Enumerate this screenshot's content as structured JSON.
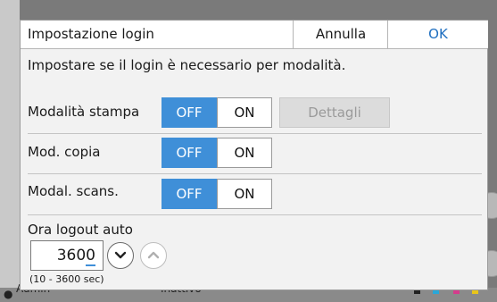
{
  "dialog": {
    "title": "Impostazione login",
    "cancel_label": "Annulla",
    "ok_label": "OK",
    "description": "Impostare se il login è necessario per modalità."
  },
  "rows": [
    {
      "label": "Modalità stampa",
      "off_label": "OFF",
      "on_label": "ON",
      "selected": "OFF",
      "details_label": "Dettagli"
    },
    {
      "label": "Mod. copia",
      "off_label": "OFF",
      "on_label": "ON",
      "selected": "OFF"
    },
    {
      "label": "Modal. scans.",
      "off_label": "OFF",
      "on_label": "ON",
      "selected": "OFF"
    }
  ],
  "logout": {
    "label": "Ora logout auto",
    "value_prefix": "360",
    "value_cursor": "0",
    "range_text": "(10 - 3600 sec)"
  },
  "background": {
    "user": "Admin",
    "state": "Inattivo",
    "ink_labels": [
      "K",
      "C",
      "M",
      "Y"
    ]
  },
  "colors": {
    "accent": "#3f8fd8",
    "ok_text": "#1f6fc0",
    "ink_k": "#222222",
    "ink_c": "#2aa7d8",
    "ink_m": "#d43c8c",
    "ink_y": "#e8c51a"
  }
}
